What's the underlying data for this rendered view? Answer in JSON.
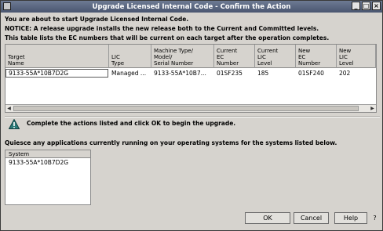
{
  "window": {
    "title": "Upgrade Licensed Internal Code - Confirm the Action",
    "controls": [
      "_",
      "□",
      "×"
    ]
  },
  "messages": {
    "line1": "You are about to start Upgrade Licensed Internal Code.",
    "line2": "NOTICE: A release upgrade installs the new release both to the Current and Committed levels.",
    "line3": "This table lists the EC numbers that will be current on each target after the operation completes."
  },
  "table": {
    "columns": [
      "Target\nName",
      "LIC\nType",
      "Machine Type/\nModel/\nSerial Number",
      "Current\nEC\nNumber",
      "Current\nLIC\nLevel",
      "New\nEC\nNumber",
      "New\nLIC\nLevel"
    ],
    "rows": [
      [
        "9133-55A*10B7D2G",
        "Managed ...",
        "9133-55A*10B7...",
        "01SF235",
        "185",
        "01SF240",
        "202"
      ]
    ]
  },
  "instruction": "Complete the actions listed and click OK to begin the upgrade.",
  "quiesce": "Quiesce any applications currently running on your operating systems for the systems listed below.",
  "system_list": {
    "header": "System",
    "items": [
      "9133-55A*10B7D2G"
    ]
  },
  "buttons": {
    "ok": "OK",
    "cancel": "Cancel",
    "help": "Help",
    "question": "?"
  }
}
